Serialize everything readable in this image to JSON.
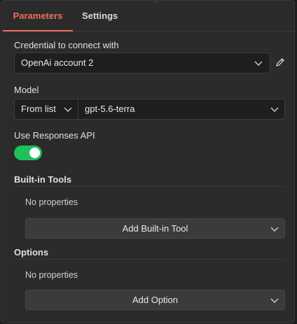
{
  "tabs": [
    {
      "label": "Parameters",
      "active": true
    },
    {
      "label": "Settings",
      "active": false
    }
  ],
  "credential": {
    "label": "Credential to connect with",
    "value": "OpenAi account 2"
  },
  "model": {
    "label": "Model",
    "mode": "From list",
    "value": "gpt-5.6-terra"
  },
  "responses_api": {
    "label": "Use Responses API",
    "enabled": true
  },
  "builtin_tools": {
    "title": "Built-in Tools",
    "empty_text": "No properties",
    "add_label": "Add Built-in Tool"
  },
  "options": {
    "title": "Options",
    "empty_text": "No properties",
    "add_label": "Add Option"
  },
  "colors": {
    "accent": "#ee6f59",
    "toggle_on": "#1fbf5a",
    "panel_bg": "#2b2b2b"
  },
  "icons": [
    "chevron-down-icon",
    "pencil-icon",
    "drag-handle-icon"
  ]
}
